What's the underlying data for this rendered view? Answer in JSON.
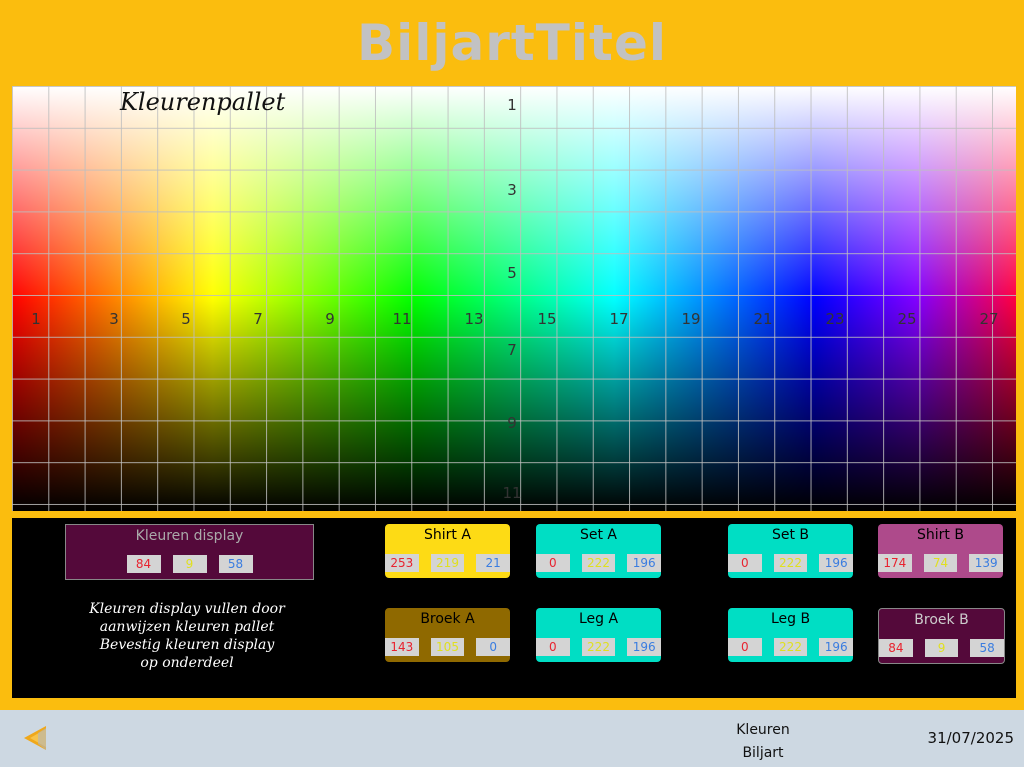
{
  "app_title": "BiljartTitel",
  "palette": {
    "title": "Kleurenpallet",
    "row_numbers": [
      "1",
      "3",
      "5",
      "7",
      "9",
      "11"
    ],
    "col_numbers": [
      "1",
      "3",
      "5",
      "7",
      "9",
      "11",
      "13",
      "15",
      "17",
      "19",
      "21",
      "23",
      "25",
      "27"
    ]
  },
  "colors": {
    "background": "#fbbd0e",
    "panel": "#000000",
    "footer": "#cdd8e2"
  },
  "display": {
    "label": "Kleuren display",
    "r": "84",
    "g": "9",
    "b": "58",
    "color": "#54093a"
  },
  "instructions": {
    "line1": "Kleuren display vullen door",
    "line2": "aanwijzen kleuren pallet",
    "line3": "Bevestig kleuren display",
    "line4": "op onderdeel"
  },
  "cards": {
    "shirt_a": {
      "label": "Shirt A",
      "r": "253",
      "g": "219",
      "b": "21",
      "color": "#fddb15",
      "text_color": "#000000"
    },
    "set_a": {
      "label": "Set A",
      "r": "0",
      "g": "222",
      "b": "196",
      "color": "#00dec4",
      "text_color": "#000000"
    },
    "set_b": {
      "label": "Set B",
      "r": "0",
      "g": "222",
      "b": "196",
      "color": "#00dec4",
      "text_color": "#000000"
    },
    "shirt_b": {
      "label": "Shirt B",
      "r": "174",
      "g": "74",
      "b": "139",
      "color": "#ae4a8b",
      "text_color": "#000000"
    },
    "broek_a": {
      "label": "Broek A",
      "r": "143",
      "g": "105",
      "b": "0",
      "color": "#8f6900",
      "text_color": "#000000"
    },
    "leg_a": {
      "label": "Leg A",
      "r": "0",
      "g": "222",
      "b": "196",
      "color": "#00dec4",
      "text_color": "#000000"
    },
    "leg_b": {
      "label": "Leg B",
      "r": "0",
      "g": "222",
      "b": "196",
      "color": "#00dec4",
      "text_color": "#000000"
    },
    "broek_b": {
      "label": "Broek B",
      "r": "84",
      "g": "9",
      "b": "58",
      "color": "#54093a",
      "text_color": "#cccccc"
    }
  },
  "footer": {
    "back_icon": "back-arrow-icon",
    "line1": "Kleuren",
    "line2": "Biljart",
    "date": "31/07/2025"
  }
}
